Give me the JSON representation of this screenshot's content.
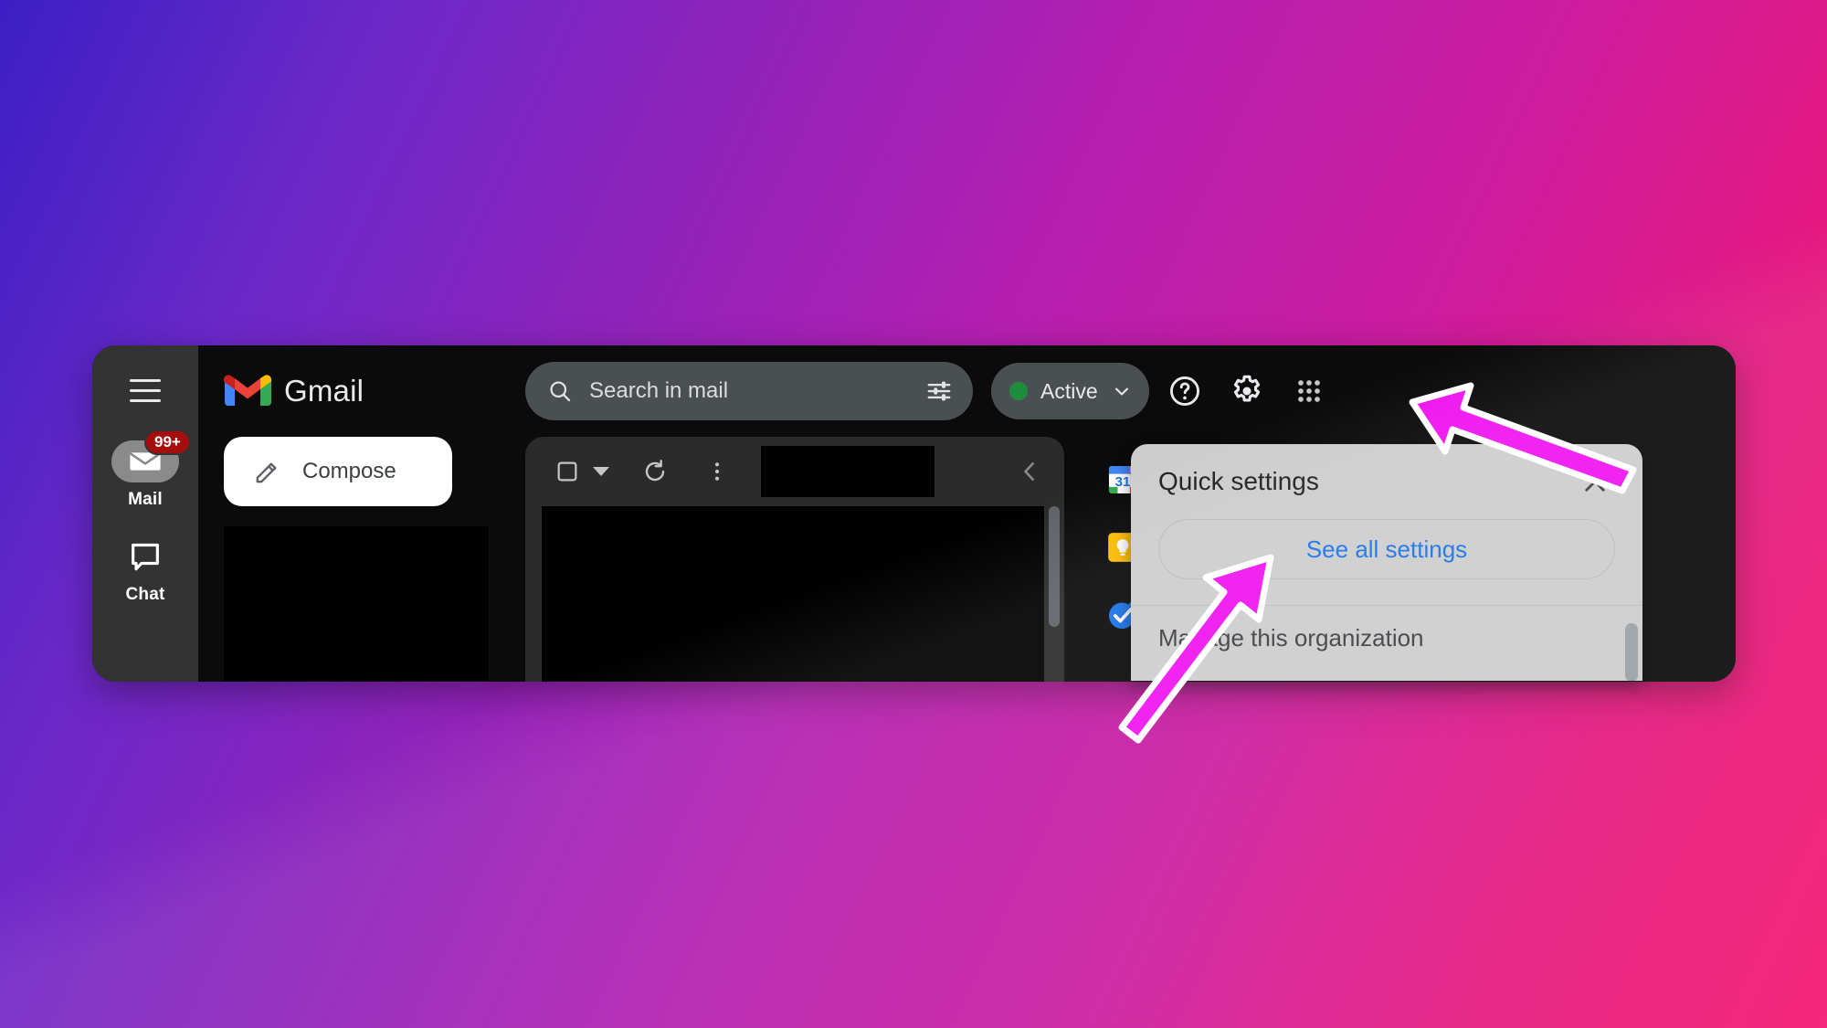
{
  "window": {
    "app_name": "Gmail"
  },
  "app_rail": {
    "menu_icon": "hamburger-menu-icon",
    "items": [
      {
        "label": "Mail",
        "icon": "mail-icon",
        "badge": "99+",
        "active": true
      },
      {
        "label": "Chat",
        "icon": "chat-bubble-icon",
        "badge": "",
        "active": false
      }
    ]
  },
  "header": {
    "logo_icon": "gmail-logo-icon",
    "brand": "Gmail",
    "search": {
      "icon": "search-icon",
      "placeholder": "Search in mail",
      "value": "",
      "options_icon": "search-options-icon"
    },
    "status": {
      "label": "Active",
      "dot_color": "#1e8e3e",
      "chevron_icon": "chevron-down-icon"
    },
    "help_icon": "help-circle-icon",
    "settings_icon": "gear-icon",
    "apps_icon": "apps-grid-icon"
  },
  "compose": {
    "label": "Compose",
    "icon": "pencil-icon"
  },
  "list_toolbar": {
    "select_all_icon": "checkbox-unchecked-icon",
    "select_dropdown_icon": "caret-down-icon",
    "refresh_icon": "refresh-icon",
    "more_icon": "more-vertical-icon",
    "collapse_icon": "chevron-left-icon"
  },
  "side_apps": [
    {
      "name": "Google Calendar",
      "icon": "calendar-icon",
      "day": "31"
    },
    {
      "name": "Google Keep",
      "icon": "keep-bulb-icon"
    },
    {
      "name": "Google Tasks",
      "icon": "tasks-check-icon"
    }
  ],
  "quick_settings": {
    "title": "Quick settings",
    "close_icon": "close-x-icon",
    "see_all_label": "See all settings",
    "rows": [
      {
        "label": "Manage this organization"
      }
    ]
  },
  "annotations": {
    "arrow_color": "#f013f0",
    "arrow_outline": "#ffffff",
    "arrows": [
      {
        "name": "arrow-to-apps-grid",
        "target": "apps-grid-icon"
      },
      {
        "name": "arrow-to-see-all-settings",
        "target": "see-all-settings-button"
      }
    ]
  },
  "colors": {
    "desktop_gradient_start": "#3b1fc4",
    "desktop_gradient_end": "#f21670",
    "window_bg": "#0b0b0b",
    "rail_bg": "#333333",
    "search_bg": "#4a4f51",
    "panel_bg": "#cdcdcd",
    "link_blue": "#1a73e8",
    "badge_red": "#a50e0e"
  }
}
